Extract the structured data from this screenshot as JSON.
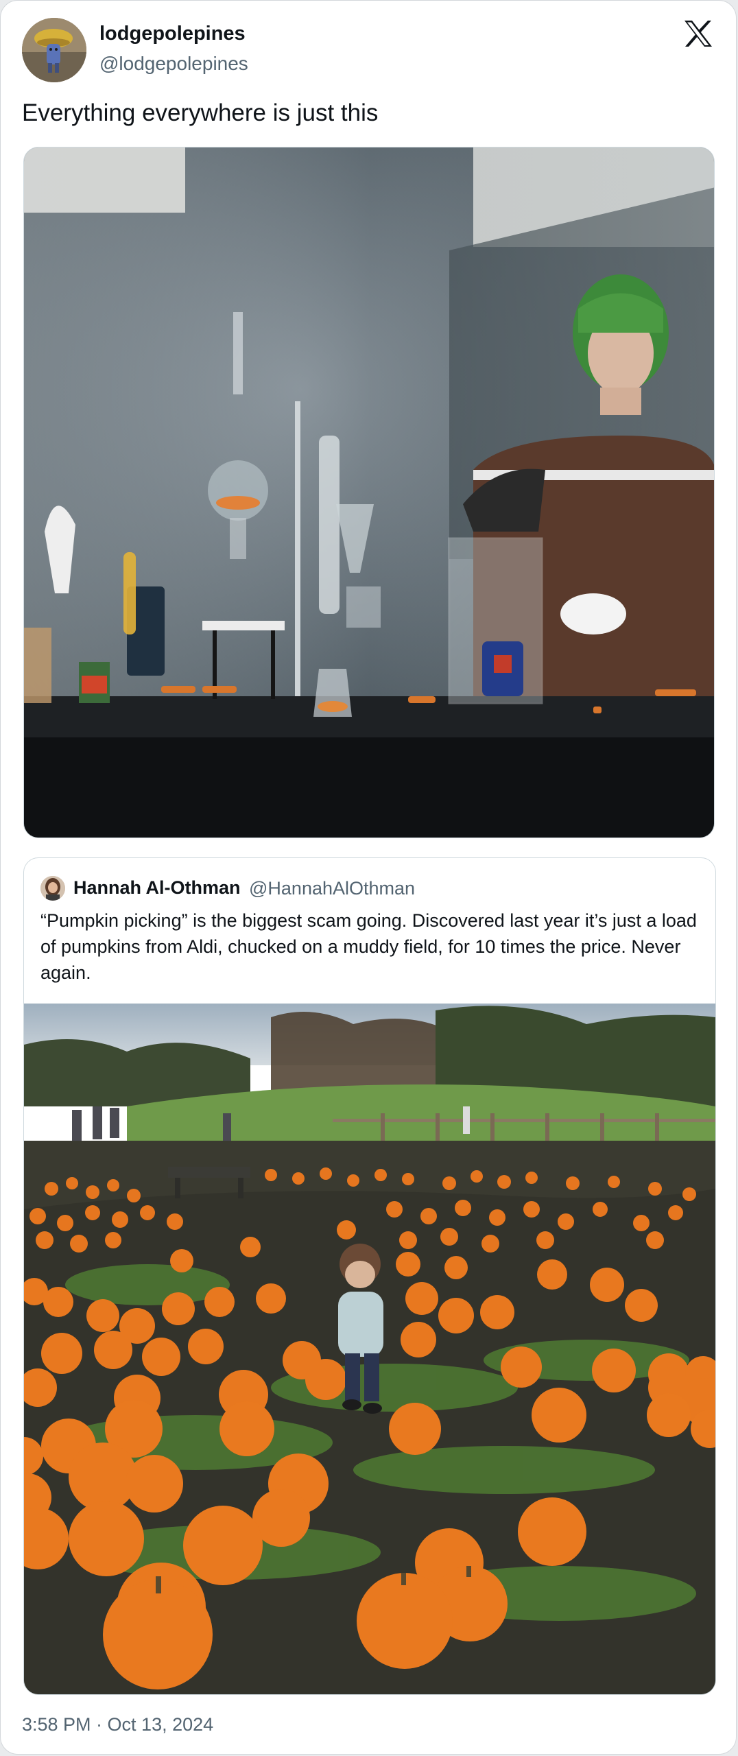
{
  "post": {
    "display_name": "lodgepolepines",
    "handle": "@lodgepolepines",
    "text": "Everything everywhere is just this",
    "avatar_icon": "mushroom-character-avatar",
    "platform_icon": "x-logo-icon",
    "timestamp": "3:58 PM · Oct 13, 2024"
  },
  "quoted": {
    "display_name": "Hannah Al-Othman",
    "handle": "@HannahAlOthman",
    "text": "“Pumpkin picking” is the biggest scam going. Discovered last year it’s just a load of pumpkins from Aldi, chucked on a muddy field, for 10 times the price. Never again.",
    "avatar_icon": "profile-photo-avatar"
  },
  "colors": {
    "text_primary": "#0f1419",
    "text_secondary": "#536471",
    "border": "#cfd9de",
    "pumpkin": "#e8761e"
  }
}
